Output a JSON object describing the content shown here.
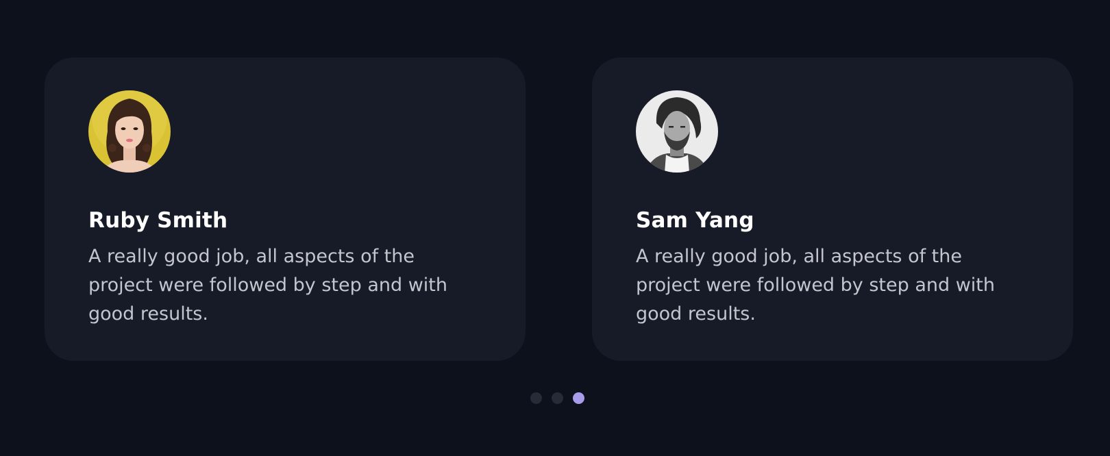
{
  "testimonials": [
    {
      "name": "Ruby Smith",
      "quote": "A really good job, all aspects of the project were followed by step and with good results.",
      "avatar_bg": "#d9c234"
    },
    {
      "name": "Sam Yang",
      "quote": "A really good job, all aspects of the project were followed by step and with good results.",
      "avatar_bg": "#ebebeb"
    }
  ],
  "pagination": {
    "count": 3,
    "active_index": 2,
    "active_color": "#a79bea",
    "inactive_color": "#262b37"
  },
  "colors": {
    "page_bg": "#0c111c",
    "card_bg": "#171b27"
  }
}
